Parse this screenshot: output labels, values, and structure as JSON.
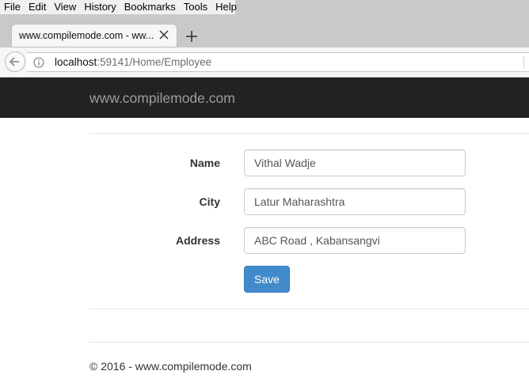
{
  "browser": {
    "menu": [
      {
        "label": "File"
      },
      {
        "label": "Edit"
      },
      {
        "label": "View"
      },
      {
        "label": "History"
      },
      {
        "label": "Bookmarks"
      },
      {
        "label": "Tools"
      },
      {
        "label": "Help"
      }
    ],
    "tab": {
      "title": "www.compilemode.com - ww..."
    },
    "url": {
      "host": "localhost",
      "rest": ":59141/Home/Employee"
    }
  },
  "navbar": {
    "brand": "www.compilemode.com"
  },
  "form": {
    "name_label": "Name",
    "name_value": "Vithal Wadje",
    "city_label": "City",
    "city_value": "Latur Maharashtra",
    "address_label": "Address",
    "address_value": "ABC Road , Kabansangvi",
    "save_label": "Save"
  },
  "footer": {
    "text": "© 2016 - www.compilemode.com"
  },
  "colors": {
    "navbar_bg": "#222222",
    "brand_text": "#9d9d9d",
    "primary_button": "#428bca"
  }
}
